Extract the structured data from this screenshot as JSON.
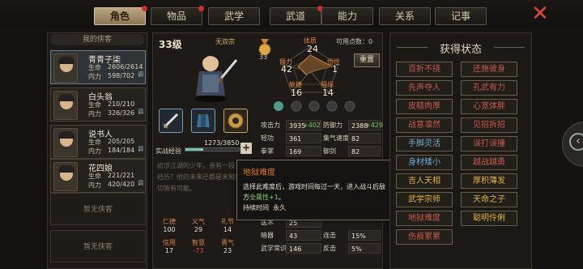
{
  "tabs": [
    {
      "label": "角色",
      "active": true,
      "badge": true
    },
    {
      "label": "物品",
      "active": false,
      "badge": true
    },
    {
      "label": "武学",
      "active": false,
      "badge": false
    },
    {
      "label": "武道",
      "active": false,
      "badge": true
    },
    {
      "label": "能力",
      "active": false,
      "badge": false
    },
    {
      "label": "关系",
      "active": false,
      "badge": false
    },
    {
      "label": "记事",
      "active": false,
      "badge": false
    }
  ],
  "party": {
    "title": "我的侠客",
    "members": [
      {
        "name": "青青子柒",
        "hp_label": "生命",
        "hp": "2606/2614",
        "mp_label": "内力",
        "mp": "598/702",
        "tune": "调",
        "selected": true
      },
      {
        "name": "白头翁",
        "hp_label": "生命",
        "hp": "210/210",
        "mp_label": "内力",
        "mp": "326/326",
        "tune": "调",
        "selected": false
      },
      {
        "name": "说书人",
        "hp_label": "生命",
        "hp": "205/205",
        "mp_label": "内力",
        "mp": "184/184",
        "tune": "调",
        "selected": false
      },
      {
        "name": "花四娘",
        "hp_label": "生命",
        "hp": "221/221",
        "mp_label": "内力",
        "mp": "420/420",
        "tune": "调",
        "selected": false
      }
    ],
    "empty_slot": "暂无侠客"
  },
  "character": {
    "level": "33级",
    "school": "无双宗",
    "medal_count": "33",
    "free_points_label": "可用点数：0",
    "reset": "重置",
    "attrs": {
      "tizhi": {
        "label": "体质",
        "value": "24"
      },
      "biли": {
        "label": "臂力",
        "value": "42"
      },
      "wuxing": {
        "label": "悟性",
        "value": "1"
      },
      "minjie": {
        "label": "敏捷",
        "value": "16"
      },
      "fuyuan": {
        "label": "福缘",
        "value": "14"
      }
    },
    "exp_label": "实战经验",
    "exp_value": "1273/3850",
    "exp_fraction": 0.33,
    "description": "初涉江湖的少年，会有一段怎样的经历？他的未来还都是未知数，一切皆有可能。",
    "virtues": [
      {
        "label": "仁德",
        "value": "100",
        "color": "#e8e0d0"
      },
      {
        "label": "义气",
        "value": "29",
        "color": "#e8e0d0"
      },
      {
        "label": "礼节",
        "value": "14",
        "color": "#e8e0d0"
      },
      {
        "label": "信用",
        "value": "17",
        "color": "#e8e0d0"
      },
      {
        "label": "智慧",
        "value": "-73",
        "color": "#e0483c"
      },
      {
        "label": "勇气",
        "value": "23",
        "color": "#e8e0d0"
      }
    ]
  },
  "stats": {
    "left": [
      {
        "label": "攻击力",
        "value": "3935",
        "bonus": "+402"
      },
      {
        "label": "轻功",
        "value": "361",
        "bonus": ""
      },
      {
        "label": "拳掌",
        "value": "169",
        "bonus": ""
      },
      {
        "label": "",
        "value": "",
        "bonus": ""
      },
      {
        "label": "",
        "value": "",
        "bonus": ""
      },
      {
        "label": "",
        "value": "",
        "bonus": ""
      },
      {
        "label": "",
        "value": "",
        "bonus": ""
      },
      {
        "label": "医术",
        "value": "25",
        "bonus": ""
      },
      {
        "label": "暗器",
        "value": "43",
        "bonus": ""
      },
      {
        "label": "武学常识",
        "value": "146",
        "bonus": ""
      }
    ],
    "right": [
      {
        "label": "防御力",
        "value": "2388",
        "bonus": "+429"
      },
      {
        "label": "集气速度",
        "value": "82",
        "bonus": ""
      },
      {
        "label": "御剑",
        "value": "82",
        "bonus": ""
      },
      {
        "label": "",
        "value": "",
        "bonus": ""
      },
      {
        "label": "",
        "value": "",
        "bonus": ""
      },
      {
        "label": "",
        "value": "",
        "bonus": ""
      },
      {
        "label": "",
        "value": "",
        "bonus": ""
      },
      {
        "label": "",
        "value": "",
        "bonus": ""
      },
      {
        "label": "连击",
        "value": "15%",
        "bonus": ""
      },
      {
        "label": "反击",
        "value": "5%",
        "bonus": ""
      }
    ]
  },
  "tooltip": {
    "title": "地狱难度",
    "body_1": "选择此难度后，游戏时间每过一天，进入战斗后敌方",
    "body_hl": "全属性+1",
    "body_2": "。",
    "duration_label": "持续时间",
    "duration": "永久"
  },
  "buffs": {
    "title": "获得状态",
    "items": [
      {
        "label": "百折不挠",
        "color": "p"
      },
      {
        "label": "还施彼身",
        "color": "p"
      },
      {
        "label": "先声夺人",
        "color": "p"
      },
      {
        "label": "孔武有力",
        "color": "p"
      },
      {
        "label": "皮糙肉厚",
        "color": "p"
      },
      {
        "label": "心宽体胖",
        "color": "p"
      },
      {
        "label": "战意凛然",
        "color": "p"
      },
      {
        "label": "见招拆招",
        "color": "p"
      },
      {
        "label": "手脚灵活",
        "color": "t"
      },
      {
        "label": "误打误撞",
        "color": "p"
      },
      {
        "label": "身材矮小",
        "color": "t"
      },
      {
        "label": "越战越勇",
        "color": "p"
      },
      {
        "label": "吉人天相",
        "color": "g"
      },
      {
        "label": "厚积薄发",
        "color": "g"
      },
      {
        "label": "武学宗师",
        "color": "g"
      },
      {
        "label": "天命之子",
        "color": "g"
      },
      {
        "label": "地狱难度",
        "color": "p"
      },
      {
        "label": "聪明伶俐",
        "color": "g"
      },
      {
        "label": "伤痕累累",
        "color": "p"
      }
    ]
  },
  "colors": {
    "accent": "#d8834a",
    "positive": "#6fca5a",
    "negative": "#e0483c",
    "buff_purple": "#c95c50",
    "buff_gold": "#e3b549",
    "buff_teal": "#6fb0d8"
  }
}
